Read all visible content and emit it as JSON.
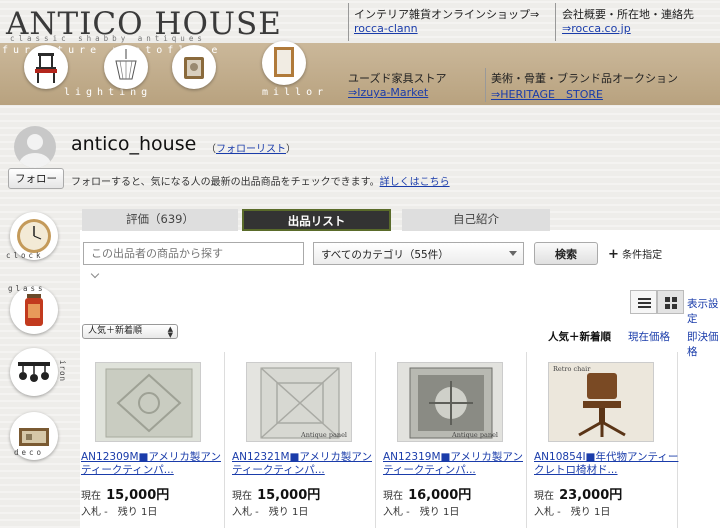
{
  "header": {
    "logo": "ANTICO HOUSE",
    "logo_sub": "classic shabby antiques",
    "strip_words_top": "furniture photoflame",
    "strip_word_lighting": "lighting",
    "strip_word_mirror": "millor",
    "links": [
      {
        "label": "インテリア雑貨オンラインショップ⇒",
        "link": "rocca-clann"
      },
      {
        "label": "会社概要・所在地・連絡先",
        "link": "⇒rocca.co.jp"
      },
      {
        "label": "ユーズド家具ストア",
        "link": "⇒Izuya-Market"
      },
      {
        "label": "美術・骨董・ブランド品オークション",
        "link": "⇒HERITAGE　STORE"
      }
    ]
  },
  "profile": {
    "username": "antico_house",
    "follow_list_open": "（",
    "follow_list_label": "フォローリスト",
    "follow_list_close": "）",
    "follow_button": "フォロー",
    "follow_note": "フォローすると、気になる人の最新の出品商品をチェックできます。",
    "follow_more": "詳しくはこちら"
  },
  "sidebar": {
    "words": [
      "clock",
      "glass",
      "iron",
      "deco"
    ]
  },
  "tabs": [
    {
      "label": "評価（639）",
      "active": false
    },
    {
      "label": "出品リスト",
      "active": true
    },
    {
      "label": "自己紹介",
      "active": false
    }
  ],
  "search": {
    "placeholder": "この出品者の商品から探す",
    "category": "すべてのカテゴリ（55件）",
    "button": "検索",
    "conditions": "条件指定"
  },
  "view": {
    "display_label": "表示設定"
  },
  "sort": {
    "selected": "人気＋新着順",
    "links": [
      "人気＋新着順",
      "現在価格",
      "即決価格"
    ]
  },
  "items": [
    {
      "title": "AN12309M■アメリカ製アンティークティンパ...",
      "price_label": "現在",
      "price": "15,000円",
      "bids": "入札 -",
      "remaining": "残り 1日"
    },
    {
      "title": "AN12321M■アメリカ製アンティークティンパ...",
      "price_label": "現在",
      "price": "15,000円",
      "bids": "入札 -",
      "remaining": "残り 1日"
    },
    {
      "title": "AN12319M■アメリカ製アンティークティンパ...",
      "price_label": "現在",
      "price": "16,000円",
      "bids": "入札 -",
      "remaining": "残り 1日"
    },
    {
      "title": "AN10854I■年代物アンティークレトロ椅材ド...",
      "price_label": "現在",
      "price": "23,000円",
      "bids": "入札 -",
      "remaining": "残り 1日"
    }
  ],
  "thumb_captions": [
    "Antique panel",
    "Antique panel",
    "Retro chair"
  ]
}
